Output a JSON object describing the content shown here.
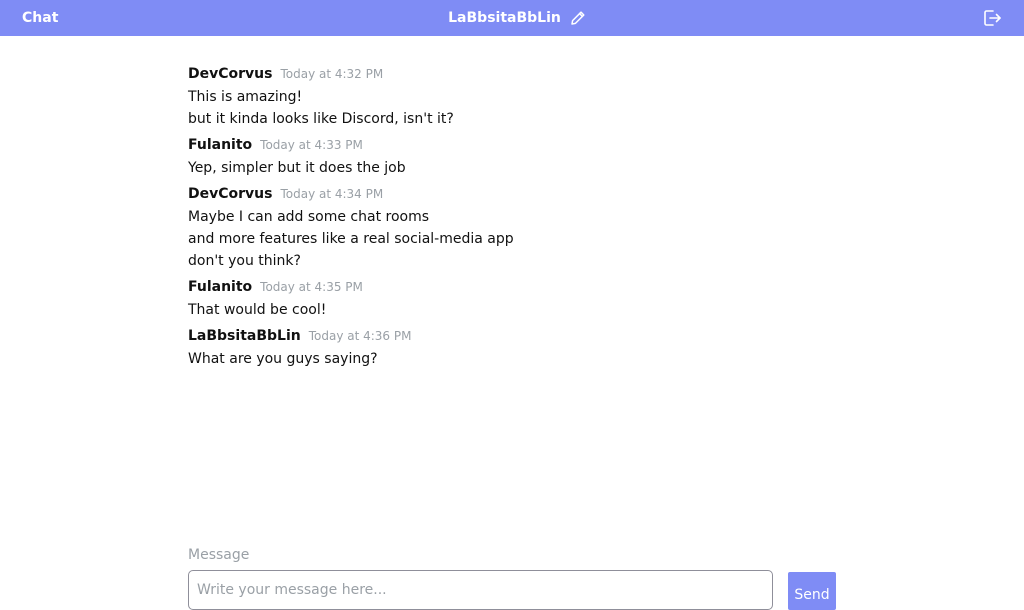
{
  "header": {
    "app_title": "Chat",
    "username": "LaBbsitaBbLin",
    "edit_icon": "pencil-icon",
    "logout_icon": "logout-icon",
    "background_color": "#7f8cf5"
  },
  "messages": [
    {
      "author": "DevCorvus",
      "time": "Today at 4:32 PM",
      "lines": [
        "This is amazing!",
        "but it kinda looks like Discord, isn't it?"
      ]
    },
    {
      "author": "Fulanito",
      "time": "Today at 4:33 PM",
      "lines": [
        "Yep, simpler but it does the job"
      ]
    },
    {
      "author": "DevCorvus",
      "time": "Today at 4:34 PM",
      "lines": [
        "Maybe I can add some chat rooms",
        "and more features like a real social-media app",
        "don't you think?"
      ]
    },
    {
      "author": "Fulanito",
      "time": "Today at 4:35 PM",
      "lines": [
        "That would be cool!"
      ]
    },
    {
      "author": "LaBbsitaBbLin",
      "time": "Today at 4:36 PM",
      "lines": [
        "What are you guys saying?"
      ]
    }
  ],
  "composer": {
    "label": "Message",
    "placeholder": "Write your message here...",
    "value": "",
    "send_label": "Send",
    "accent_color": "#7f8cf5"
  }
}
